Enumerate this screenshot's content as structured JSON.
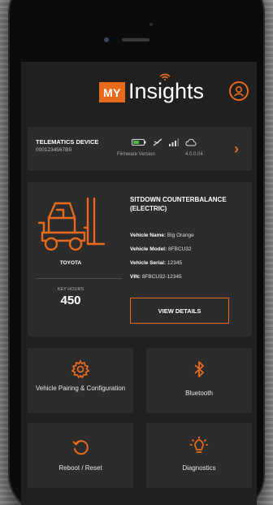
{
  "app": {
    "brand_badge": "MY",
    "brand_name": "Insights"
  },
  "telematics": {
    "title": "TELEMATICS DEVICE",
    "device_id": "0001234567B9",
    "firmware_label": "Firmware Version",
    "firmware_value": "4.0.0.04"
  },
  "vehicle": {
    "type": "SITDOWN COUNTERBALANCE (ELECTRIC)",
    "make": "TOYOTA",
    "key_hours_label": "KEY HOURS",
    "key_hours_value": "450",
    "name_label": "Vehicle Name:",
    "name_value": "Big Orange",
    "model_label": "Vehicle Model:",
    "model_value": "8FBCU32",
    "serial_label": "Vehicle Serial:",
    "serial_value": "12345",
    "vin_label": "VIN:",
    "vin_value": "8FBCU32-12345",
    "view_details": "VIEW DETAILS"
  },
  "tiles": [
    {
      "label": "Vehicle Pairing & Configuration",
      "icon": "gear-icon"
    },
    {
      "label": "Bluetooth",
      "icon": "bluetooth-icon"
    },
    {
      "label": "Reboot / Reset",
      "icon": "reboot-icon"
    },
    {
      "label": "Diagnostics",
      "icon": "diagnostics-icon"
    }
  ],
  "colors": {
    "accent": "#e86a1c",
    "screen_bg": "#202020",
    "card_bg": "#2c2c2c"
  }
}
